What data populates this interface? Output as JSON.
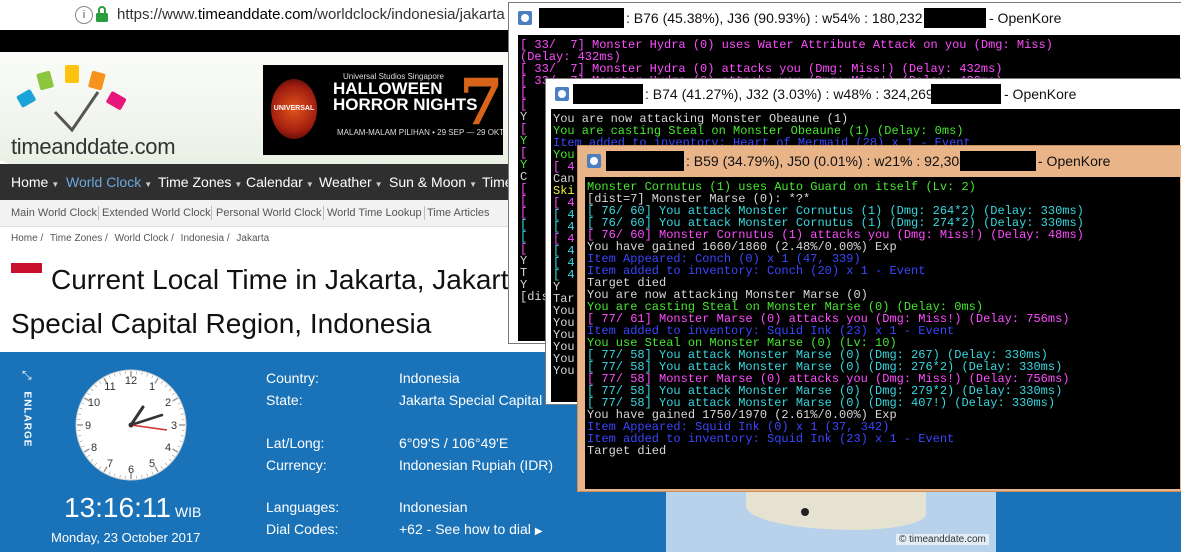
{
  "browser": {
    "url_prefix": "https://www.",
    "url_domain": "timeanddate.com",
    "url_path": "/worldclock/indonesia/jakarta",
    "logo_text": "timeanddate.com",
    "banner": {
      "line1": "Universal Studios Singapore",
      "line2a": "HALLOWEEN",
      "line2b": "HORROR NIGHTS",
      "line3": "MALAM-MALAM PILIHAN • 29 SEP — 29 OKT",
      "badge": "UNIVERSAL STUDIOS",
      "number": "7"
    },
    "nav": [
      {
        "label": "Home",
        "active": false
      },
      {
        "label": "World Clock",
        "active": true
      },
      {
        "label": "Time Zones",
        "active": false
      },
      {
        "label": "Calendar",
        "active": false
      },
      {
        "label": "Weather",
        "active": false
      },
      {
        "label": "Sun & Moon",
        "active": false
      },
      {
        "label": "Time",
        "active": false
      }
    ],
    "subnav": [
      "Main World Clock",
      "Extended World Clock",
      "Personal World Clock",
      "World Time Lookup",
      "Time Articles"
    ],
    "breadcrumb": [
      "Home /",
      "Time Zones /",
      "World Clock /",
      "Indonesia /",
      "Jakarta"
    ],
    "title": "Current Local Time in Jakarta, Jakarta Special Capital Region, Indonesia",
    "enlarge_label": "ENLARGE",
    "clock": {
      "time": "13:16:11",
      "tz": "WIB",
      "date": "Monday, 23 October 2017",
      "numbers": [
        "12",
        "1",
        "2",
        "3",
        "4",
        "5",
        "6",
        "7",
        "8",
        "9",
        "10",
        "11"
      ]
    },
    "info": [
      {
        "label": "Country:",
        "value": "Indonesia"
      },
      {
        "label": "State:",
        "value": "Jakarta Special Capital"
      },
      {
        "label": "Lat/Long:",
        "value": "6°09'S / 106°49'E"
      },
      {
        "label": "Currency:",
        "value": "Indonesian Rupiah (IDR)"
      },
      {
        "label": "Languages:",
        "value": "Indonesian"
      },
      {
        "label": "Dial Codes:",
        "value": "+62 - See how to dial"
      }
    ],
    "map_credit": "© timeanddate.com",
    "colors": {
      "nav_bg": "#2f2f2f",
      "panel_blue": "#1a73b8",
      "active_nav": "#6ea6e0",
      "flag_red": "#c8102e"
    }
  },
  "windows": [
    {
      "title_stats": ":  B76 (45.38%), J36 (90.93%) : w54% : 180,232",
      "title_app": "- OpenKore",
      "lines": [
        {
          "text": "[ 33/  7] Monster Hydra (0) uses Water Attribute Attack on you (Dmg: Miss)",
          "color": "mag"
        },
        {
          "text": "(Delay: 432ms)",
          "color": "mag"
        },
        {
          "text": "[ 33/  7] Monster Hydra (0) attacks you (Dmg: Miss!) (Delay: 432ms)",
          "color": "mag"
        },
        {
          "text": "[ 33/  7] Monster Hydra (0) attacks you (Dmg: Miss!) (Delay: 432ms)",
          "color": "mag"
        },
        {
          "text": "[",
          "color": "mag"
        },
        {
          "text": "[",
          "color": "mag"
        },
        {
          "text": "Y",
          "color": "wht"
        },
        {
          "text": "[",
          "color": "mag"
        },
        {
          "text": "Y",
          "color": "grn"
        },
        {
          "text": "[",
          "color": "mag"
        },
        {
          "text": "Y",
          "color": "grn"
        },
        {
          "text": "C",
          "color": "wht"
        },
        {
          "text": "[",
          "color": "mag"
        },
        {
          "text": "[",
          "color": "mag"
        },
        {
          "text": "[",
          "color": "mag"
        },
        {
          "text": "[",
          "color": "cyn"
        },
        {
          "text": "[",
          "color": "cyn"
        },
        {
          "text": "[",
          "color": "mag"
        },
        {
          "text": "Y",
          "color": "wht"
        },
        {
          "text": "T",
          "color": "wht"
        },
        {
          "text": "Y",
          "color": "wht"
        },
        {
          "text": "[dis",
          "color": "wht"
        }
      ]
    },
    {
      "title_stats": ":  B74 (41.27%), J32 (3.03%) : w48% : 324,269",
      "title_app": "- OpenKore",
      "lines": [
        {
          "text": "You are now attacking Monster Obeaune (1)",
          "color": "wht"
        },
        {
          "text": "You are casting Steal on Monster Obeaune (1) (Delay: 0ms)",
          "color": "grn"
        },
        {
          "text": "Item added to inventory: Heart of Mermaid (28) x 1 - Event",
          "color": "blu"
        },
        {
          "text": "You",
          "color": "grn"
        },
        {
          "text": "[ 4",
          "color": "mag"
        },
        {
          "text": "Can",
          "color": "wht"
        },
        {
          "text": "Ski",
          "color": "yel"
        },
        {
          "text": "[ 4",
          "color": "mag"
        },
        {
          "text": "[ 4",
          "color": "cyn"
        },
        {
          "text": "[ 4",
          "color": "cyn"
        },
        {
          "text": "[ 4",
          "color": "mag"
        },
        {
          "text": "[ 4",
          "color": "cyn"
        },
        {
          "text": "[ 4",
          "color": "cyn"
        },
        {
          "text": "[ 4",
          "color": "cyn"
        },
        {
          "text": "Y",
          "color": "wht"
        },
        {
          "text": "Tar",
          "color": "wht"
        },
        {
          "text": "You",
          "color": "wht"
        },
        {
          "text": "You",
          "color": "wht"
        },
        {
          "text": "You",
          "color": "wht"
        },
        {
          "text": "You",
          "color": "wht"
        },
        {
          "text": "You",
          "color": "wht"
        },
        {
          "text": "You",
          "color": "wht"
        }
      ]
    },
    {
      "title_stats": ":  B59 (34.79%), J50 (0.01%) : w21% : 92,303",
      "title_app": "- OpenKore",
      "lines": [
        {
          "text": "Monster Cornutus (1) uses Auto Guard on itself (Lv: 2)",
          "color": "grn"
        },
        {
          "text": "[dist=7] Monster Marse (0): *?*",
          "color": "wht"
        },
        {
          "text": "[ 76/ 60] You attack Monster Cornutus (1) (Dmg: 264*2) (Delay: 330ms)",
          "color": "cyn"
        },
        {
          "text": "[ 76/ 60] You attack Monster Cornutus (1) (Dmg: 274*2) (Delay: 330ms)",
          "color": "cyn"
        },
        {
          "text": "[ 76/ 60] Monster Cornutus (1) attacks you (Dmg: Miss!) (Delay: 48ms)",
          "color": "mag"
        },
        {
          "text": "You have gained 1660/1860 (2.48%/0.00%) Exp",
          "color": "wht"
        },
        {
          "text": "Item Appeared: Conch (0) x 1 (47, 339)",
          "color": "blu"
        },
        {
          "text": "Item added to inventory: Conch (20) x 1 - Event",
          "color": "blu"
        },
        {
          "text": "Target died",
          "color": "wht"
        },
        {
          "text": "You are now attacking Monster Marse (0)",
          "color": "wht"
        },
        {
          "text": "You are casting Steal on Monster Marse (0) (Delay: 0ms)",
          "color": "grn"
        },
        {
          "text": "[ 77/ 61] Monster Marse (0) attacks you (Dmg: Miss!) (Delay: 756ms)",
          "color": "mag"
        },
        {
          "text": "Item added to inventory: Squid Ink (23) x 1 - Event",
          "color": "blu"
        },
        {
          "text": "You use Steal on Monster Marse (0) (Lv: 10)",
          "color": "grn"
        },
        {
          "text": "[ 77/ 58] You attack Monster Marse (0) (Dmg: 267) (Delay: 330ms)",
          "color": "cyn"
        },
        {
          "text": "[ 77/ 58] You attack Monster Marse (0) (Dmg: 276*2) (Delay: 330ms)",
          "color": "cyn"
        },
        {
          "text": "[ 77/ 58] Monster Marse (0) attacks you (Dmg: Miss!) (Delay: 756ms)",
          "color": "mag"
        },
        {
          "text": "[ 77/ 58] You attack Monster Marse (0) (Dmg: 279*2) (Delay: 330ms)",
          "color": "cyn"
        },
        {
          "text": "[ 77/ 58] You attack Monster Marse (0) (Dmg: 407!) (Delay: 330ms)",
          "color": "cyn"
        },
        {
          "text": "You have gained 1750/1970 (2.61%/0.00%) Exp",
          "color": "wht"
        },
        {
          "text": "Item Appeared: Squid Ink (0) x 1 (37, 342)",
          "color": "blu"
        },
        {
          "text": "Item added to inventory: Squid Ink (23) x 1 - Event",
          "color": "blu"
        },
        {
          "text": "Target died",
          "color": "wht"
        }
      ]
    }
  ]
}
